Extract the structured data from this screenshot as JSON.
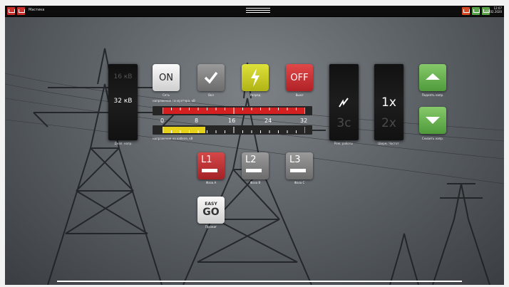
{
  "topbar": {
    "app_title": "Мастика",
    "clock_time": "12:07",
    "clock_date": "02.02.2020"
  },
  "voltage_selector": {
    "options": [
      "16 кВ",
      "32 кВ"
    ],
    "selected": "32 кВ",
    "label": "Днап. напр."
  },
  "buttons": {
    "network": {
      "text": "ON",
      "label": "Сеть"
    },
    "all": {
      "label": "Вкл"
    },
    "discharge": {
      "label": "Разряд"
    },
    "off": {
      "text": "OFF",
      "label": "Выкл"
    }
  },
  "generator_bar": {
    "label": "напряжение генератора, кВ",
    "level_fraction": 1.0,
    "color": "#d42020"
  },
  "cable_bar": {
    "label": "напряжение на кабеле, кВ",
    "level_fraction": 0.3,
    "color": "#e6d21a",
    "scale": [
      "0",
      "8",
      "16",
      "24",
      "32"
    ]
  },
  "mode_panel": {
    "options": [
      "3с"
    ],
    "label": "Реж. работы"
  },
  "multiplier_panel": {
    "options": [
      "1x",
      "2x"
    ],
    "selected": "1x",
    "label": "Ширм. Частот"
  },
  "raise_button": {
    "label": "Поднять напр."
  },
  "lower_button": {
    "label": "Снизить напр."
  },
  "phases": [
    {
      "text": "L1",
      "label": "Фаза A",
      "active": true
    },
    {
      "text": "L2",
      "label": "Фаза B",
      "active": false
    },
    {
      "text": "L3",
      "label": "Фаза C",
      "active": false
    }
  ],
  "easy_go": {
    "line1": "EASY",
    "line2": "GO",
    "label": "Прожиг"
  },
  "colors": {
    "accent_red": "#c4282c",
    "accent_green": "#6ab651",
    "accent_yellow": "#c8cb1d"
  }
}
